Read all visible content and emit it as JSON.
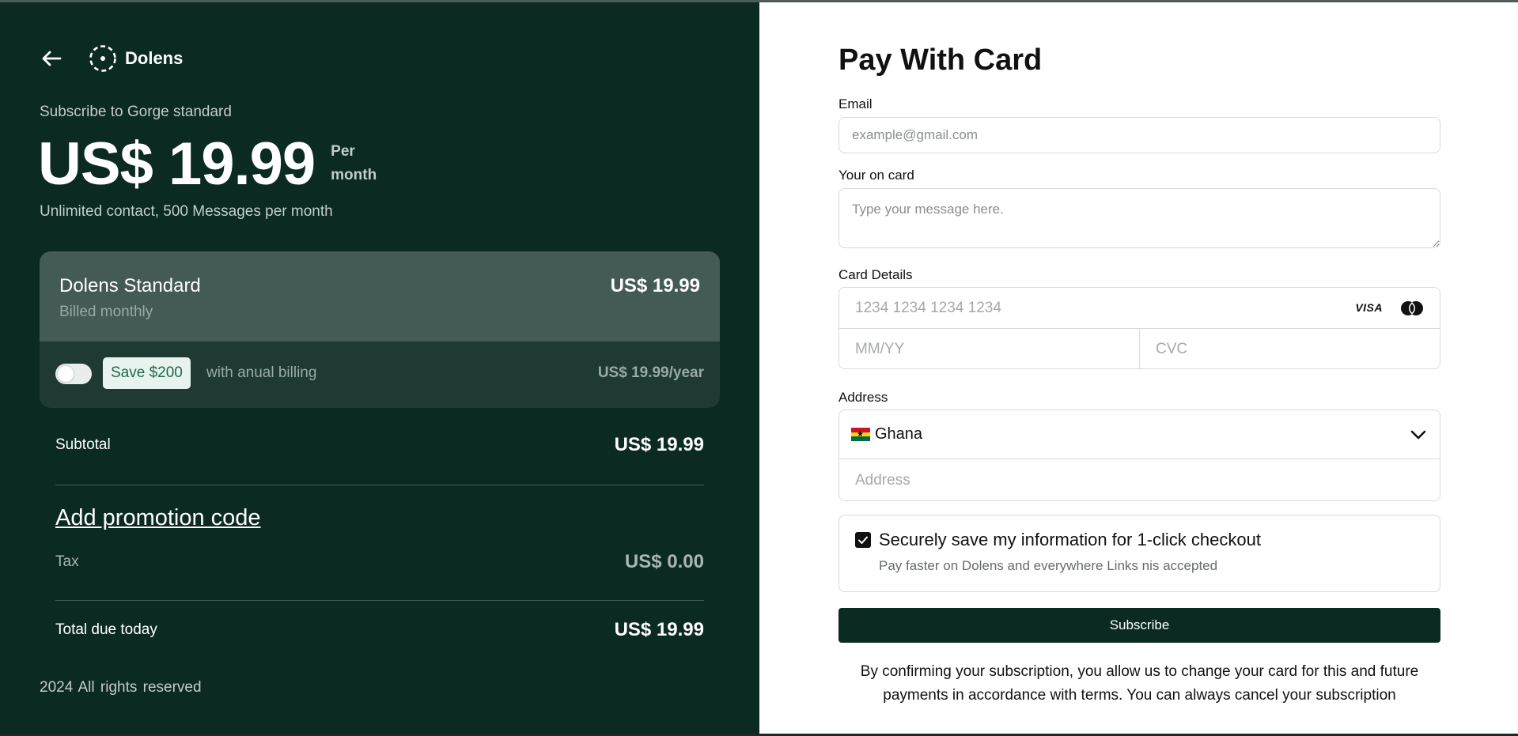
{
  "brand": {
    "name": "Dolens",
    "back_icon": "arrow-left-icon",
    "logo_icon": "dashed-circle-dot-icon"
  },
  "summary": {
    "subscribe_to": "Subscribe to Gorge standard",
    "price": "US$ 19.99",
    "period": "Per month",
    "features": "Unlimited contact, 500 Messages per month"
  },
  "plan": {
    "name": "Dolens Standard",
    "billing": "Billed monthly",
    "price": "US$  19.99",
    "annual_toggle_on": false,
    "save_badge": "Save $200",
    "annual_text": "with anual billing",
    "annual_price": "US$ 19.99/year"
  },
  "totals": {
    "subtotal_label": "Subtotal",
    "subtotal_value": "US$  19.99",
    "promo_link": "Add promotion code",
    "tax_label": "Tax",
    "tax_value": "US$  0.00",
    "total_label": "Total due today",
    "total_value": "US$  19.99"
  },
  "footer": {
    "text": "2024  All rights reserved"
  },
  "form": {
    "title": "Pay With Card",
    "email_label": "Email",
    "email_placeholder": "example@gmail.com",
    "name_label": "Your on card",
    "name_placeholder": "Type your message here.",
    "card_label": "Card Details",
    "card_number_placeholder": "1234 1234 1234 1234",
    "card_brands": [
      "VISA",
      "mastercard-icon"
    ],
    "expiry_placeholder": "MM/YY",
    "cvc_placeholder": "CVC",
    "address_label": "Address",
    "country": "Ghana",
    "country_flag": "ghana-flag-icon",
    "address_placeholder": "Address",
    "save_checked": true,
    "save_title": "Securely save my information for 1-click checkout",
    "save_subtitle": "Pay faster on Dolens and everywhere Links nis accepted",
    "subscribe_button": "Subscribe",
    "terms": "By confirming your subscription, you allow us to change your card for this and future payments in accordance with terms. You can always cancel your subscription"
  },
  "colors": {
    "panel_dark": "#0b2a22",
    "plan_header": "#445a54",
    "badge_bg": "#e8f2ee",
    "badge_text": "#1d6b4a",
    "button": "#0b2a22"
  }
}
